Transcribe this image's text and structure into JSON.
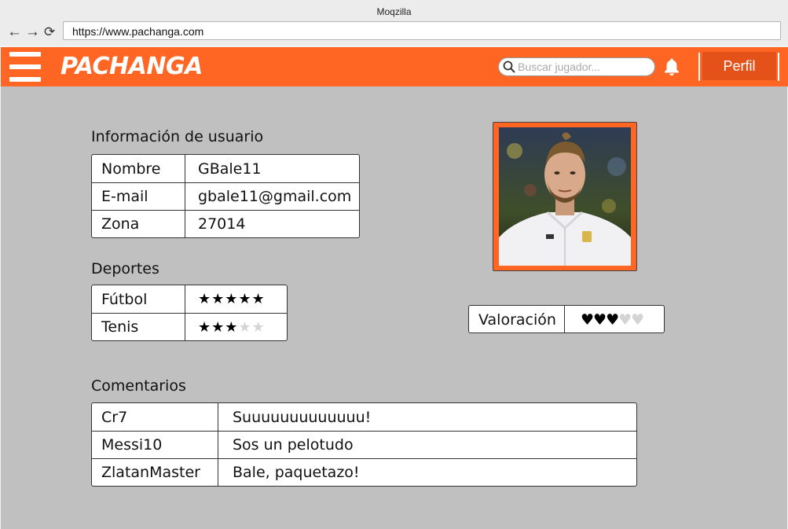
{
  "browser": {
    "window_title": "Moqzilla",
    "url": "https://www.pachanga.com"
  },
  "header": {
    "logo": "PACHANGA",
    "search_placeholder": "Buscar jugador...",
    "profile_label": "Perfil",
    "accent_color": "#ff6624"
  },
  "user_info": {
    "title": "Información de usuario",
    "rows": [
      {
        "label": "Nombre",
        "value": "GBale11"
      },
      {
        "label": "E-mail",
        "value": "gbale11@gmail.com"
      },
      {
        "label": "Zona",
        "value": "27014"
      }
    ]
  },
  "sports": {
    "title": "Deportes",
    "rows": [
      {
        "name": "Fútbol",
        "stars_filled": "★★★★★",
        "stars_empty": "",
        "rating": 5,
        "max": 5
      },
      {
        "name": "Tenis",
        "stars_filled": "★★★",
        "stars_empty": "★★",
        "rating": 3,
        "max": 5
      }
    ]
  },
  "rating": {
    "label": "Valoración",
    "hearts_filled": "♥♥♥",
    "hearts_empty": "♥♥",
    "value": 3,
    "max": 5
  },
  "comments": {
    "title": "Comentarios",
    "rows": [
      {
        "user": "Cr7",
        "text": "Suuuuuuuuuuuuu!"
      },
      {
        "user": "Messi10",
        "text": "Sos un pelotudo"
      },
      {
        "user": "ZlatanMaster",
        "text": "Bale, paquetazo!"
      }
    ]
  }
}
